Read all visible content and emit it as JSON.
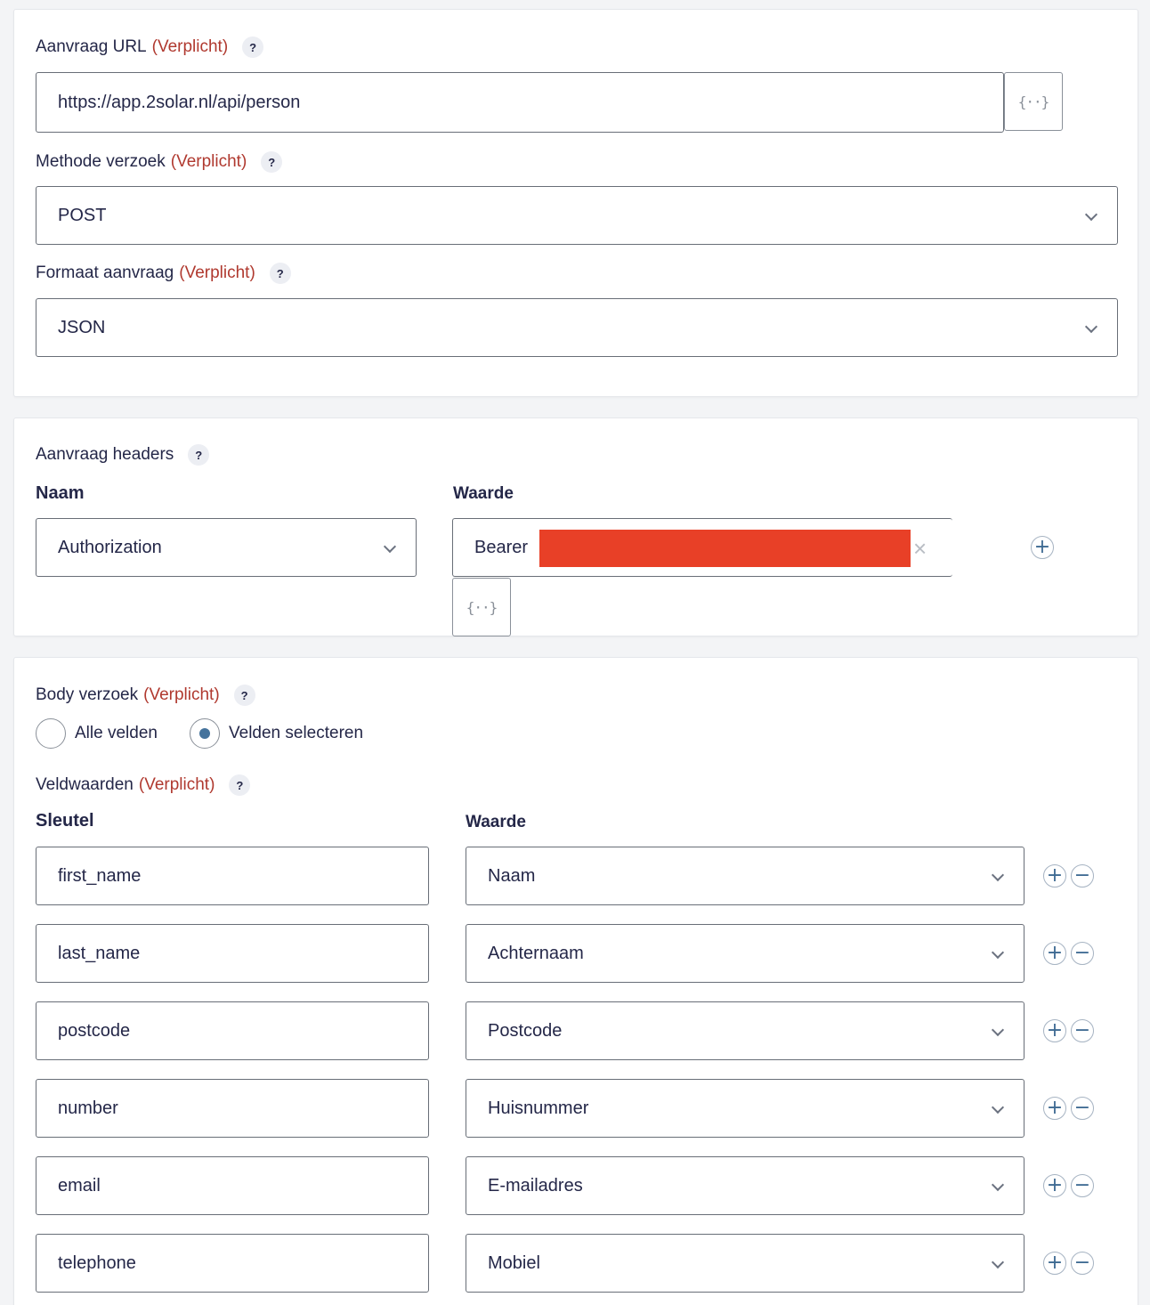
{
  "request": {
    "url_label": "Aanvraag URL",
    "required_text": "(Verplicht)",
    "help_glyph": "?",
    "url_value": "https://app.2solar.nl/api/person",
    "method_label": "Methode verzoek",
    "method_value": "POST",
    "format_label": "Formaat aanvraag",
    "format_value": "JSON",
    "merge_tag_glyph": "{··}"
  },
  "headers": {
    "section_label": "Aanvraag headers",
    "col_name": "Naam",
    "col_value": "Waarde",
    "name_value": "Authorization",
    "value_prefix": "Bearer",
    "clear_glyph": "×",
    "add_glyph": "+"
  },
  "body": {
    "label": "Body verzoek",
    "option_all": "Alle velden",
    "option_select": "Velden selecteren",
    "selected_option": "Velden selecteren",
    "field_values_label": "Veldwaarden",
    "col_key": "Sleutel",
    "col_value": "Waarde",
    "rows": [
      {
        "key": "first_name",
        "value": "Naam"
      },
      {
        "key": "last_name",
        "value": "Achternaam"
      },
      {
        "key": "postcode",
        "value": "Postcode"
      },
      {
        "key": "number",
        "value": "Huisnummer"
      },
      {
        "key": "email",
        "value": "E-mailadres"
      },
      {
        "key": "telephone",
        "value": "Mobiel"
      }
    ],
    "add_glyph": "+",
    "remove_glyph": "−"
  },
  "colors": {
    "required": "#b0392f",
    "text": "#242748",
    "border": "#686e77",
    "redaction": "#e84027",
    "button_icon": "#3e6a92"
  }
}
